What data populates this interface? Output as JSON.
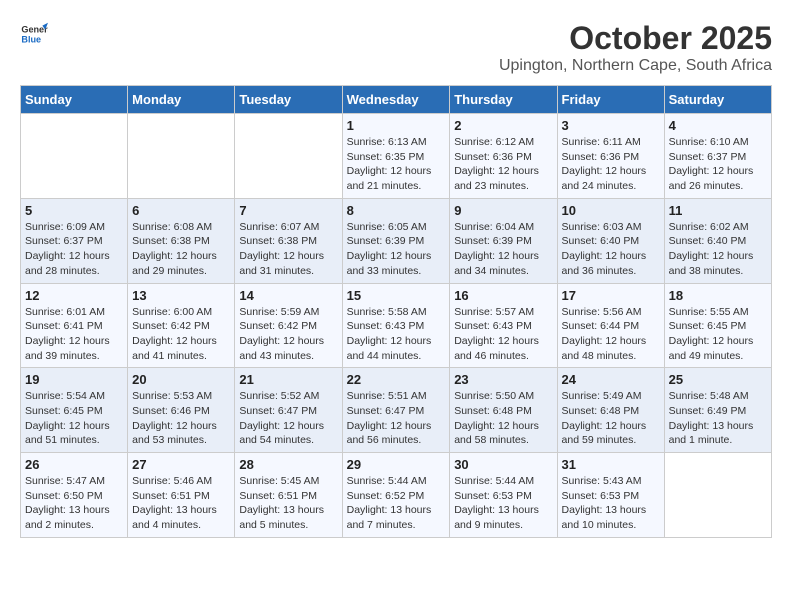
{
  "logo": {
    "line1": "General",
    "line2": "Blue"
  },
  "title": "October 2025",
  "subtitle": "Upington, Northern Cape, South Africa",
  "headers": [
    "Sunday",
    "Monday",
    "Tuesday",
    "Wednesday",
    "Thursday",
    "Friday",
    "Saturday"
  ],
  "weeks": [
    [
      {
        "day": "",
        "info": ""
      },
      {
        "day": "",
        "info": ""
      },
      {
        "day": "",
        "info": ""
      },
      {
        "day": "1",
        "info": "Sunrise: 6:13 AM\nSunset: 6:35 PM\nDaylight: 12 hours\nand 21 minutes."
      },
      {
        "day": "2",
        "info": "Sunrise: 6:12 AM\nSunset: 6:36 PM\nDaylight: 12 hours\nand 23 minutes."
      },
      {
        "day": "3",
        "info": "Sunrise: 6:11 AM\nSunset: 6:36 PM\nDaylight: 12 hours\nand 24 minutes."
      },
      {
        "day": "4",
        "info": "Sunrise: 6:10 AM\nSunset: 6:37 PM\nDaylight: 12 hours\nand 26 minutes."
      }
    ],
    [
      {
        "day": "5",
        "info": "Sunrise: 6:09 AM\nSunset: 6:37 PM\nDaylight: 12 hours\nand 28 minutes."
      },
      {
        "day": "6",
        "info": "Sunrise: 6:08 AM\nSunset: 6:38 PM\nDaylight: 12 hours\nand 29 minutes."
      },
      {
        "day": "7",
        "info": "Sunrise: 6:07 AM\nSunset: 6:38 PM\nDaylight: 12 hours\nand 31 minutes."
      },
      {
        "day": "8",
        "info": "Sunrise: 6:05 AM\nSunset: 6:39 PM\nDaylight: 12 hours\nand 33 minutes."
      },
      {
        "day": "9",
        "info": "Sunrise: 6:04 AM\nSunset: 6:39 PM\nDaylight: 12 hours\nand 34 minutes."
      },
      {
        "day": "10",
        "info": "Sunrise: 6:03 AM\nSunset: 6:40 PM\nDaylight: 12 hours\nand 36 minutes."
      },
      {
        "day": "11",
        "info": "Sunrise: 6:02 AM\nSunset: 6:40 PM\nDaylight: 12 hours\nand 38 minutes."
      }
    ],
    [
      {
        "day": "12",
        "info": "Sunrise: 6:01 AM\nSunset: 6:41 PM\nDaylight: 12 hours\nand 39 minutes."
      },
      {
        "day": "13",
        "info": "Sunrise: 6:00 AM\nSunset: 6:42 PM\nDaylight: 12 hours\nand 41 minutes."
      },
      {
        "day": "14",
        "info": "Sunrise: 5:59 AM\nSunset: 6:42 PM\nDaylight: 12 hours\nand 43 minutes."
      },
      {
        "day": "15",
        "info": "Sunrise: 5:58 AM\nSunset: 6:43 PM\nDaylight: 12 hours\nand 44 minutes."
      },
      {
        "day": "16",
        "info": "Sunrise: 5:57 AM\nSunset: 6:43 PM\nDaylight: 12 hours\nand 46 minutes."
      },
      {
        "day": "17",
        "info": "Sunrise: 5:56 AM\nSunset: 6:44 PM\nDaylight: 12 hours\nand 48 minutes."
      },
      {
        "day": "18",
        "info": "Sunrise: 5:55 AM\nSunset: 6:45 PM\nDaylight: 12 hours\nand 49 minutes."
      }
    ],
    [
      {
        "day": "19",
        "info": "Sunrise: 5:54 AM\nSunset: 6:45 PM\nDaylight: 12 hours\nand 51 minutes."
      },
      {
        "day": "20",
        "info": "Sunrise: 5:53 AM\nSunset: 6:46 PM\nDaylight: 12 hours\nand 53 minutes."
      },
      {
        "day": "21",
        "info": "Sunrise: 5:52 AM\nSunset: 6:47 PM\nDaylight: 12 hours\nand 54 minutes."
      },
      {
        "day": "22",
        "info": "Sunrise: 5:51 AM\nSunset: 6:47 PM\nDaylight: 12 hours\nand 56 minutes."
      },
      {
        "day": "23",
        "info": "Sunrise: 5:50 AM\nSunset: 6:48 PM\nDaylight: 12 hours\nand 58 minutes."
      },
      {
        "day": "24",
        "info": "Sunrise: 5:49 AM\nSunset: 6:48 PM\nDaylight: 12 hours\nand 59 minutes."
      },
      {
        "day": "25",
        "info": "Sunrise: 5:48 AM\nSunset: 6:49 PM\nDaylight: 13 hours\nand 1 minute."
      }
    ],
    [
      {
        "day": "26",
        "info": "Sunrise: 5:47 AM\nSunset: 6:50 PM\nDaylight: 13 hours\nand 2 minutes."
      },
      {
        "day": "27",
        "info": "Sunrise: 5:46 AM\nSunset: 6:51 PM\nDaylight: 13 hours\nand 4 minutes."
      },
      {
        "day": "28",
        "info": "Sunrise: 5:45 AM\nSunset: 6:51 PM\nDaylight: 13 hours\nand 5 minutes."
      },
      {
        "day": "29",
        "info": "Sunrise: 5:44 AM\nSunset: 6:52 PM\nDaylight: 13 hours\nand 7 minutes."
      },
      {
        "day": "30",
        "info": "Sunrise: 5:44 AM\nSunset: 6:53 PM\nDaylight: 13 hours\nand 9 minutes."
      },
      {
        "day": "31",
        "info": "Sunrise: 5:43 AM\nSunset: 6:53 PM\nDaylight: 13 hours\nand 10 minutes."
      },
      {
        "day": "",
        "info": ""
      }
    ]
  ]
}
